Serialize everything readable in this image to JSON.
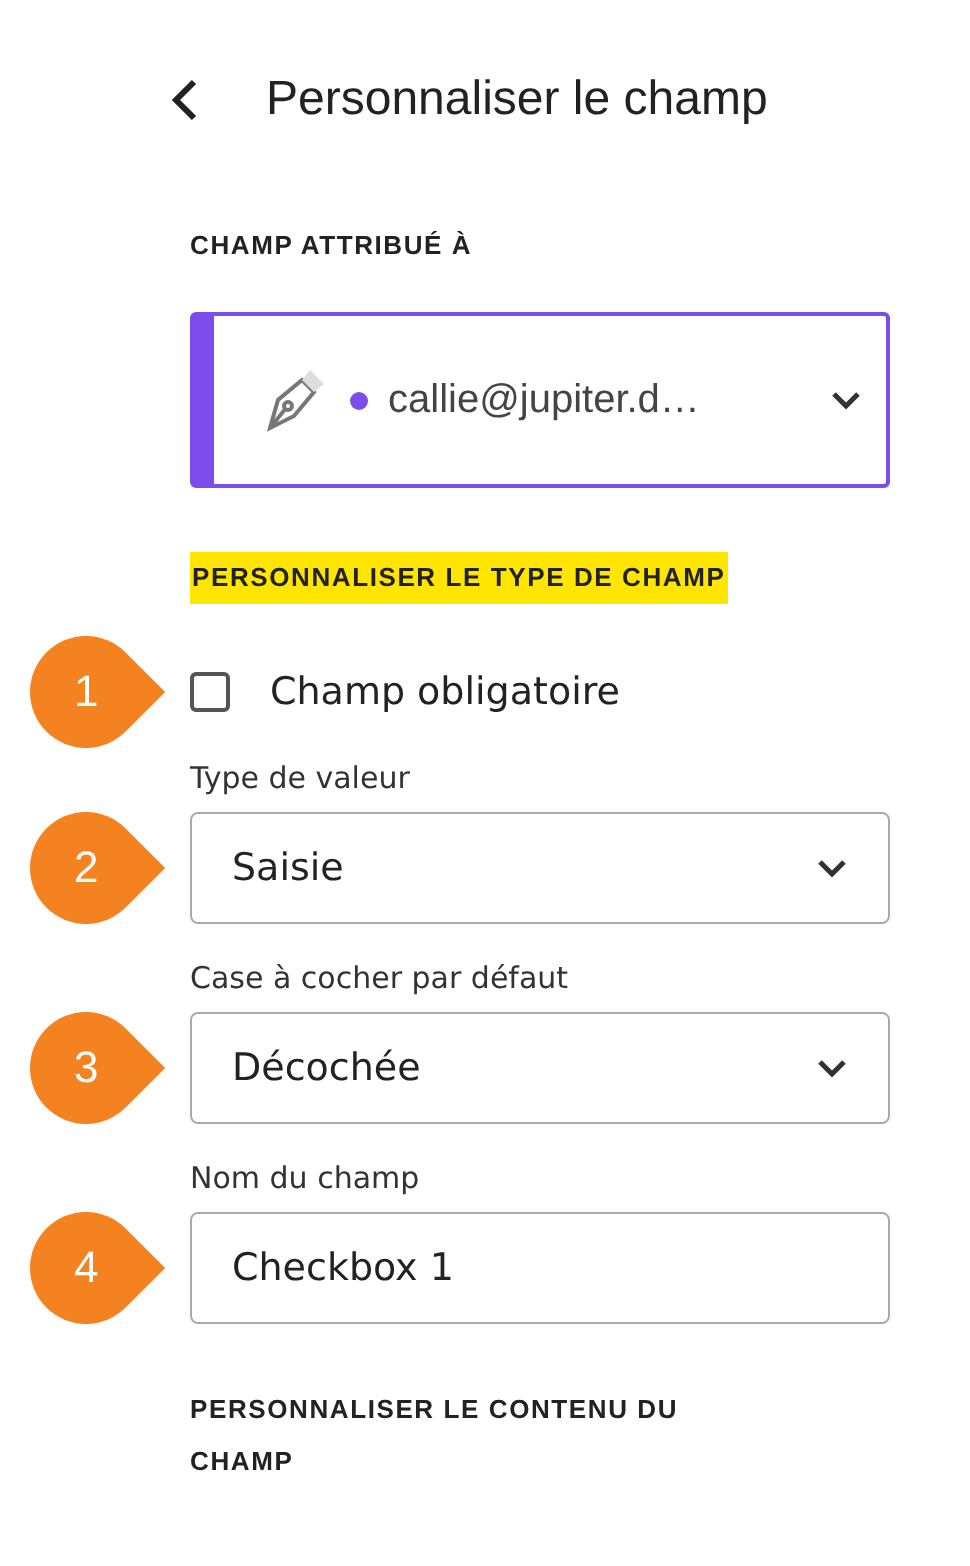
{
  "header": {
    "title": "Personnaliser le champ"
  },
  "assigned": {
    "heading": "CHAMP ATTRIBUÉ À",
    "value": "callie@jupiter.d…",
    "color": "#7c4dea"
  },
  "type_section": {
    "heading": "PERSONNALISER LE TYPE DE CHAMP",
    "highlighted": true
  },
  "fields": [
    {
      "kind": "checkbox",
      "callout": "1",
      "label": "Champ obligatoire",
      "checked": false
    },
    {
      "kind": "select",
      "callout": "2",
      "label": "Type de valeur",
      "value": "Saisie"
    },
    {
      "kind": "select",
      "callout": "3",
      "label": "Case à cocher par défaut",
      "value": "Décochée"
    },
    {
      "kind": "input",
      "callout": "4",
      "label": "Nom du champ",
      "value": "Checkbox 1"
    }
  ],
  "content_section": {
    "heading": "PERSONNALISER LE CONTENU DU CHAMP"
  }
}
